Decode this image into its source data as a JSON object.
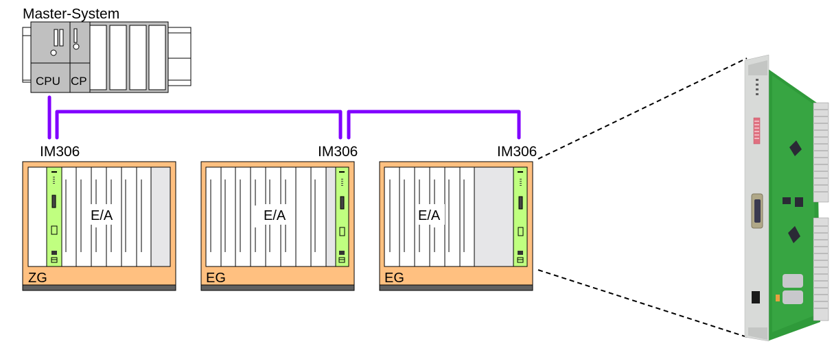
{
  "master": {
    "title": "Master-System",
    "cpu_label": "CPU",
    "cp_label": "CP"
  },
  "racks": [
    {
      "interface_label": "IM306",
      "io_label": "E/A",
      "rack_label": "ZG",
      "im_position": "left"
    },
    {
      "interface_label": "IM306",
      "io_label": "E/A",
      "rack_label": "EG",
      "im_position": "right"
    },
    {
      "interface_label": "IM306",
      "io_label": "E/A",
      "rack_label": "EG",
      "im_position": "right"
    }
  ],
  "colors": {
    "bus": "#8000ff",
    "rack_frame": "#ffc080",
    "rack_base": "#606060",
    "im_module": "#c0ff80",
    "master_module": "#c0c0c0",
    "empty_slot": "#e6e6e8"
  },
  "photo": {
    "description": "IM306 interface module circuit board (photo)"
  }
}
